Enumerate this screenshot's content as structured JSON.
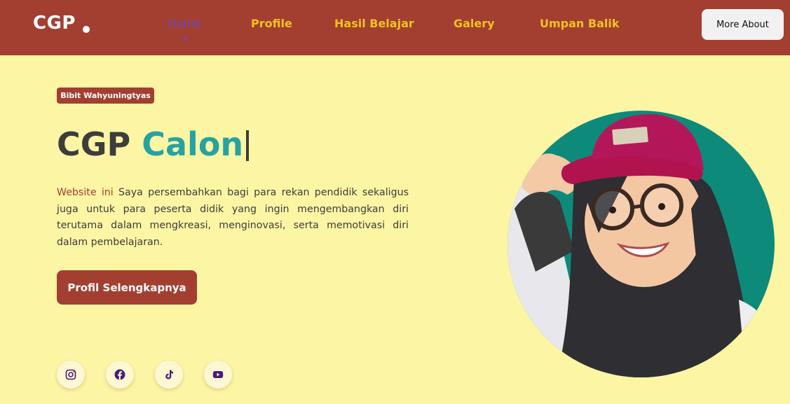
{
  "header": {
    "logo_text": "CGP",
    "nav": [
      {
        "label": "Home",
        "active": true
      },
      {
        "label": "Profile",
        "active": false
      },
      {
        "label": "Hasil Belajar",
        "active": false
      },
      {
        "label": "Galery",
        "active": false
      },
      {
        "label": "Umpan Balik",
        "active": false
      }
    ],
    "more_button": "More About"
  },
  "hero": {
    "badge": "Bibit Wahyuningtyas",
    "headline_part1": "CGP",
    "headline_part2": "Calon",
    "description_accent": "Website ini",
    "description_rest": " Saya persembahkan bagi para rekan pendidik sekaligus juga untuk para peserta didik yang ingin mengembangkan diri terutama dalam mengkreasi, menginovasi, serta memotivasi diri dalam pembelajaran.",
    "cta_label": "Profil Selengkapnya"
  },
  "social": [
    {
      "icon": "instagram-icon"
    },
    {
      "icon": "facebook-icon"
    },
    {
      "icon": "tiktok-icon"
    },
    {
      "icon": "youtube-icon"
    }
  ],
  "colors": {
    "header_bg": "#a33f31",
    "page_bg": "#fcf5a4",
    "nav_link": "#f2c21e",
    "nav_active": "#6a45c9",
    "accent_teal": "#27a2a2",
    "social_icon": "#4a1d7a"
  }
}
